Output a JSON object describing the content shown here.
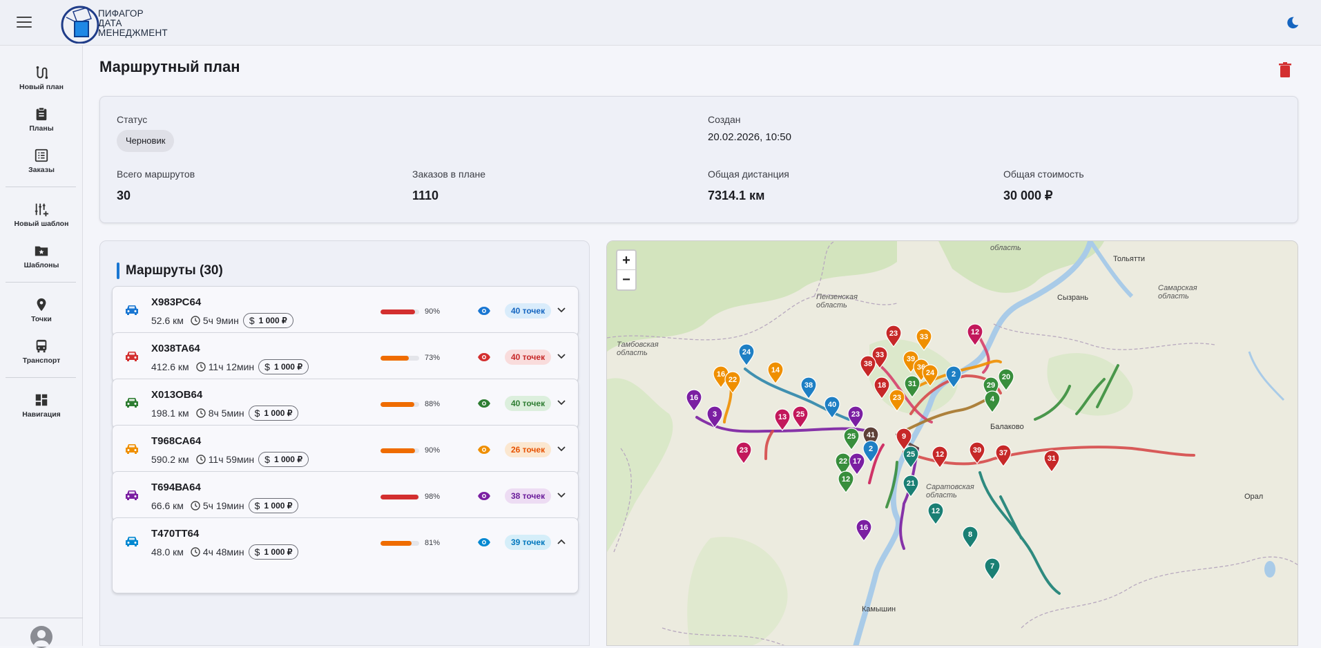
{
  "app": {
    "logo_lines": [
      "ПИФАГОР",
      "ДАТА",
      "МЕНЕДЖМЕНТ"
    ]
  },
  "sidebar": {
    "items": [
      {
        "label": "Новый план",
        "icon": "route-icon"
      },
      {
        "label": "Планы",
        "icon": "clipboard-icon"
      },
      {
        "label": "Заказы",
        "icon": "list-icon"
      },
      {
        "label": "Новый шаблон",
        "icon": "sliders-plus-icon"
      },
      {
        "label": "Шаблоны",
        "icon": "folder-star-icon"
      },
      {
        "label": "Точки",
        "icon": "pin-icon"
      },
      {
        "label": "Транспорт",
        "icon": "bus-icon"
      },
      {
        "label": "Навигация",
        "icon": "dashboard-icon"
      }
    ]
  },
  "page": {
    "title": "Маршрутный план"
  },
  "summary": {
    "status_label": "Статус",
    "status_value": "Черновик",
    "created_label": "Создан",
    "created_value": "20.02.2026, 10:50",
    "total_routes_label": "Всего маршрутов",
    "total_routes_value": "30",
    "orders_label": "Заказов в плане",
    "orders_value": "1110",
    "distance_label": "Общая дистанция",
    "distance_value": "7314.1 км",
    "cost_label": "Общая стоимость",
    "cost_value": "30 000 ₽"
  },
  "routes": {
    "title": "Маршруты (30)",
    "items": [
      {
        "plate": "Х983РС64",
        "distance": "52.6 км",
        "duration": "5ч 9мин",
        "cost": "1 000 ₽",
        "load_pct": 90,
        "load_label": "90%",
        "points": "40 точек",
        "color": "#1976d2",
        "bar_color": "#d32f2f",
        "chip_bg": "#d9ecfb",
        "chip_fg": "#1565c0"
      },
      {
        "plate": "Х038ТА64",
        "distance": "412.6 км",
        "duration": "11ч 12мин",
        "cost": "1 000 ₽",
        "load_pct": 73,
        "load_label": "73%",
        "points": "40 точек",
        "color": "#d32f2f",
        "bar_color": "#ef6c00",
        "chip_bg": "#f9dcdc",
        "chip_fg": "#c62828"
      },
      {
        "plate": "Х013ОВ64",
        "distance": "198.1 км",
        "duration": "8ч 5мин",
        "cost": "1 000 ₽",
        "load_pct": 88,
        "load_label": "88%",
        "points": "40 точек",
        "color": "#2e7d32",
        "bar_color": "#ef6c00",
        "chip_bg": "#dcefdd",
        "chip_fg": "#2e7d32"
      },
      {
        "plate": "Т968СА64",
        "distance": "590.2 км",
        "duration": "11ч 59мин",
        "cost": "1 000 ₽",
        "load_pct": 90,
        "load_label": "90%",
        "points": "26 точек",
        "color": "#ef8f00",
        "bar_color": "#ef6c00",
        "chip_bg": "#fbe7d0",
        "chip_fg": "#e65100"
      },
      {
        "plate": "Т694ВА64",
        "distance": "66.6 км",
        "duration": "5ч 19мин",
        "cost": "1 000 ₽",
        "load_pct": 98,
        "load_label": "98%",
        "points": "38 точек",
        "color": "#7b1fa2",
        "bar_color": "#d32f2f",
        "chip_bg": "#eddcf3",
        "chip_fg": "#6a1b9a"
      },
      {
        "plate": "Т470ТТ64",
        "distance": "48.0 км",
        "duration": "4ч 48мин",
        "cost": "1 000 ₽",
        "load_pct": 81,
        "load_label": "81%",
        "points": "39 точек",
        "color": "#0288d1",
        "bar_color": "#ef6c00",
        "chip_bg": "#d5eef9",
        "chip_fg": "#0277bd"
      }
    ]
  },
  "map": {
    "zoom_in": "+",
    "zoom_out": "−",
    "labels": [
      "Пензенская область",
      "Тамбовская область",
      "Сызрань",
      "Тольятти",
      "Самарская область",
      "Орал",
      "Камышин",
      "Балаково",
      "Саратовская область",
      "область"
    ],
    "markers": [
      "24",
      "16",
      "22",
      "14",
      "38",
      "16",
      "3",
      "13",
      "25",
      "23",
      "23",
      "33",
      "38",
      "18",
      "12",
      "23",
      "33",
      "39",
      "36",
      "24",
      "2",
      "29",
      "20",
      "4",
      "31",
      "40",
      "23",
      "25",
      "41",
      "9",
      "25",
      "12",
      "39",
      "37",
      "31",
      "21",
      "12",
      "8",
      "7",
      "22",
      "12",
      "16",
      "17",
      "2"
    ]
  }
}
